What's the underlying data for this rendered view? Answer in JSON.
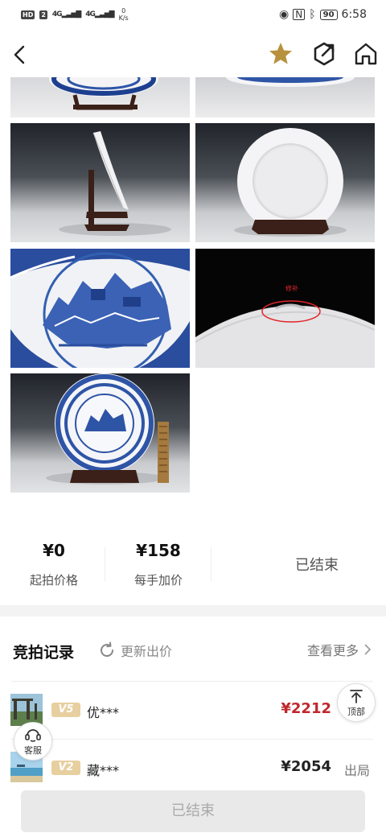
{
  "status_bar": {
    "hd_badge": "HD",
    "sim": "2",
    "signal1": "4G",
    "signal2": "4G",
    "net_speed_value": "0",
    "net_speed_unit": "K/s",
    "battery": "90",
    "time": "6:58"
  },
  "nav": {
    "back_icon": "chevron-left-icon",
    "favorite_icon": "star-icon",
    "share_icon": "share-icon",
    "home_icon": "home-icon",
    "favorite_color": "#b8913f"
  },
  "gallery": {
    "annotation_text": "修补"
  },
  "auction": {
    "start_price": "¥0",
    "start_price_label": "起拍价格",
    "increment": "¥158",
    "increment_label": "每手加价",
    "status": "已结束"
  },
  "bids": {
    "title": "竞拍记录",
    "refresh_label": "更新出价",
    "see_more_label": "查看更多",
    "rows": [
      {
        "vip": "V5",
        "bidder": "优***",
        "price": "¥2212",
        "price_color": "#c0262d"
      },
      {
        "vip": "V2",
        "bidder": "藏***",
        "price": "¥2054",
        "state": "出局",
        "price_color": "#222222"
      }
    ]
  },
  "floating": {
    "top_label": "顶部",
    "service_label": "客服"
  },
  "bottom": {
    "button_label": "已结束"
  }
}
